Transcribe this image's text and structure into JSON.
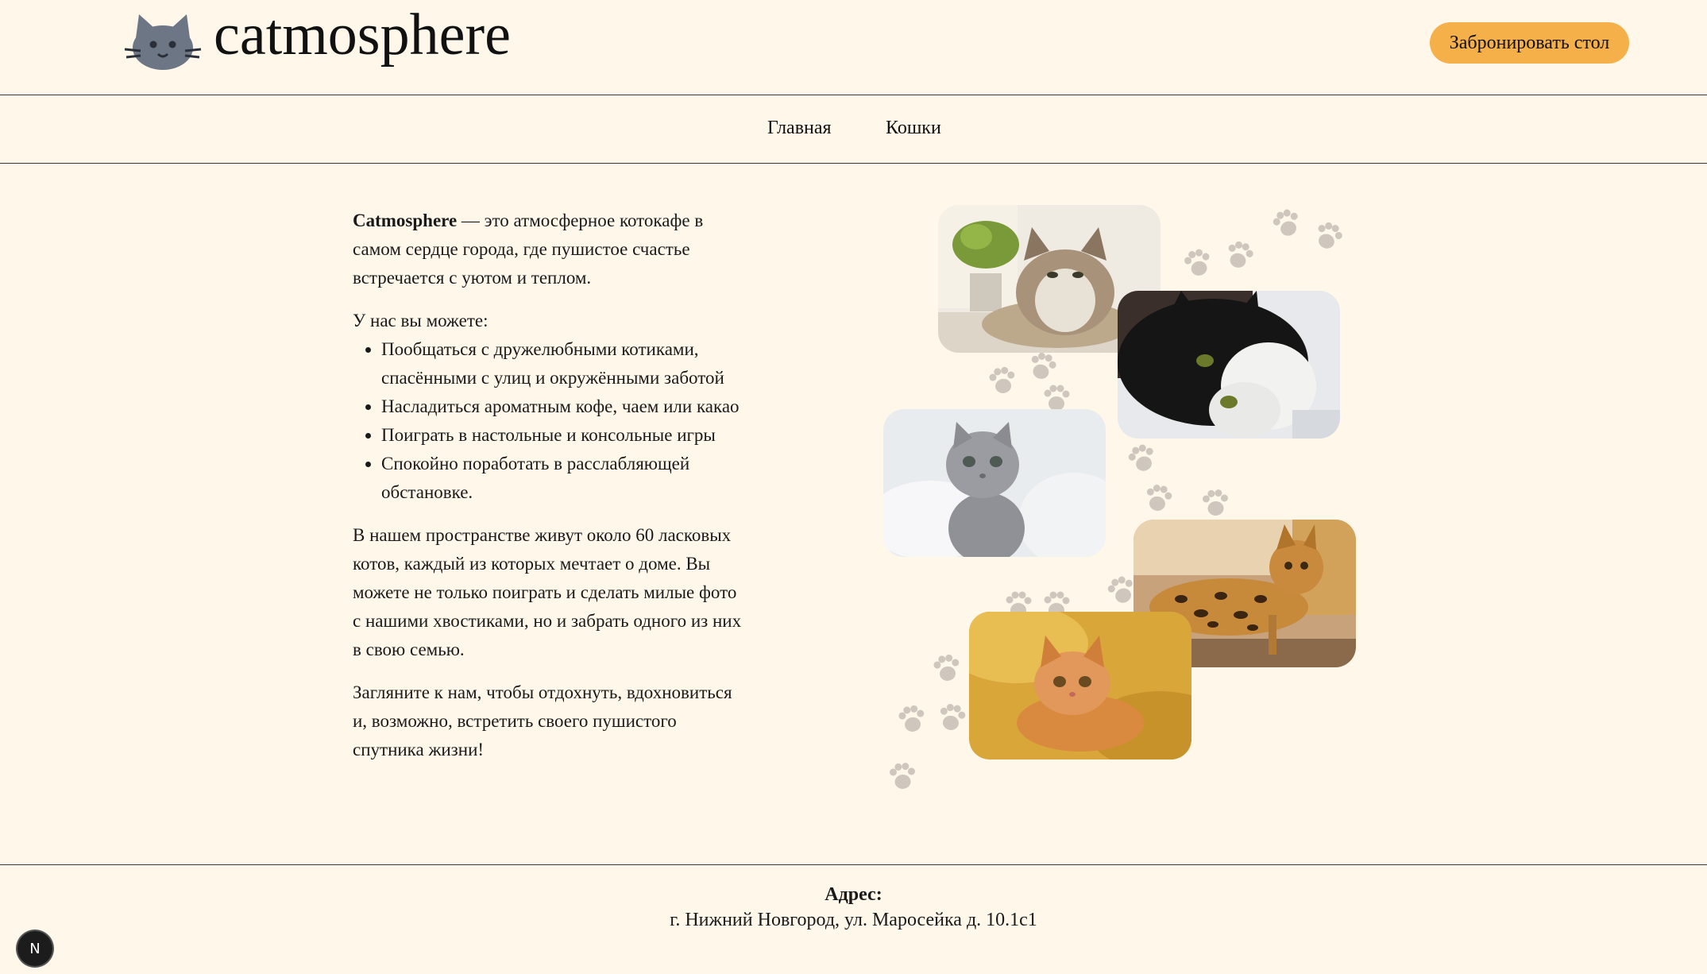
{
  "header": {
    "logo_text": "catmosphere",
    "logo_icon": "cat-face-icon",
    "book_button": "Забронировать стол"
  },
  "nav": {
    "items": [
      {
        "label": "Главная"
      },
      {
        "label": "Кошки"
      }
    ]
  },
  "about": {
    "brand": "Catmosphere",
    "intro_rest": " — это атмосферное котокафе в самом сердце города, где пушистое счастье встречается с уютом и теплом.",
    "list_title": "У нас вы можете:",
    "list": [
      "Пообщаться с дружелюбными котиками, спасёнными с улиц и окружёнными заботой",
      "Насладиться ароматным кофе, чаем или какао",
      "Поиграть в настольные и консольные игры",
      "Спокойно поработать в расслабляющей обстановке."
    ],
    "para2": "В нашем пространстве живут около 60 ласковых котов, каждый из которых мечтает о доме. Вы можете не только поиграть и сделать милые фото с нашими хвостиками, но и забрать одного из них в свою семью.",
    "para3": "Загляните к нам, чтобы отдохнуть, вдохновиться и, возможно, встретить своего пушистого спутника жизни!"
  },
  "gallery": {
    "photos": [
      {
        "name": "tabby-cat-photo"
      },
      {
        "name": "black-white-cat-photo"
      },
      {
        "name": "grey-kitten-photo"
      },
      {
        "name": "bengal-cat-photo"
      },
      {
        "name": "ginger-kitten-photo"
      }
    ],
    "decoration": "paw-prints"
  },
  "footer": {
    "address_title": "Адрес:",
    "address": "г. Нижний Новгород, ул. Маросейка д. 10.1с1"
  },
  "dev_badge": {
    "label": "N"
  },
  "colors": {
    "background": "#fff8ea",
    "accent": "#f5b04a",
    "paw": "#cfc6bd"
  }
}
